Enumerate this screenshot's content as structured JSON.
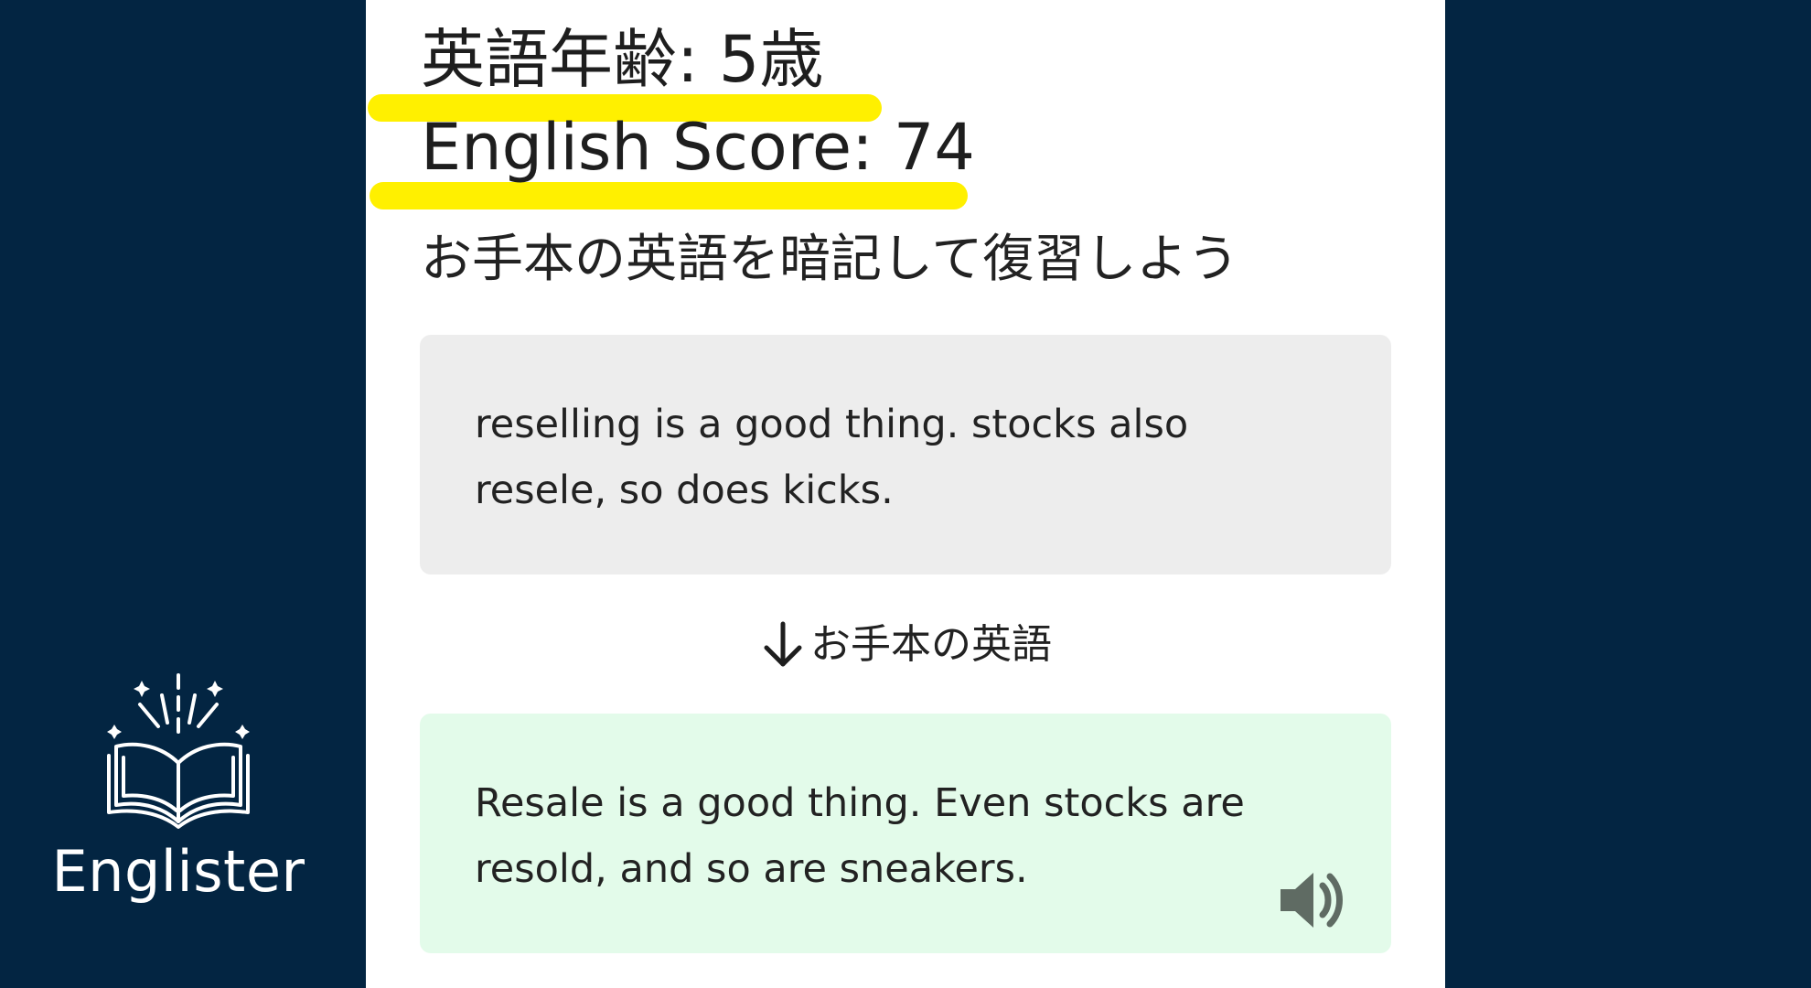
{
  "brand": {
    "name": "Englister"
  },
  "result": {
    "age_line": "英語年齢: 5歳",
    "score_line": "English Score: 74"
  },
  "instruction": "お手本の英語を暗記して復習しよう",
  "user_answer": {
    "text": "reselling is a good thing. stocks also resele, so does kicks."
  },
  "divider": {
    "label": "お手本の英語"
  },
  "model_answer": {
    "text": "Resale is a good thing. Even stocks are resold, and so are sneakers."
  },
  "icons": {
    "logo": "open-book-sparkle-icon",
    "arrow": "arrow-down-icon",
    "speaker": "speaker-icon"
  },
  "colors": {
    "background": "#032542",
    "highlight": "#fff000",
    "user_box": "#ededed",
    "model_box": "#e3fbea",
    "speaker": "#5f6b63"
  }
}
